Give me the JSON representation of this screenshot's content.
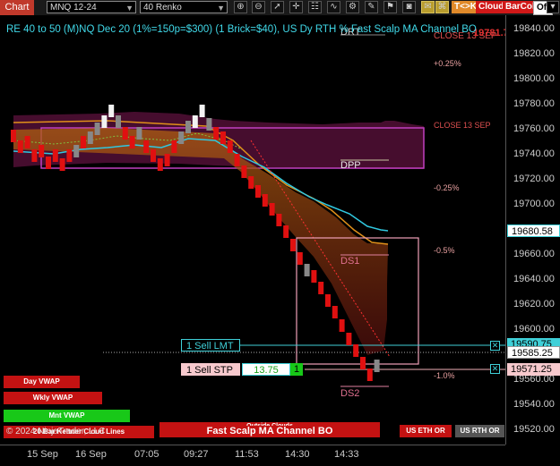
{
  "toolbar": {
    "chart_tab": "Chart",
    "instrument": "MNQ 12-24",
    "period": "40 Renko",
    "flags": [
      {
        "label": "T<>K",
        "color": "#e08a2a"
      },
      {
        "label": "Cloud",
        "color": "#d01818"
      },
      {
        "label": "BarCol",
        "color": "#d01818"
      },
      {
        "label": "Off",
        "color": "#ffffff"
      }
    ]
  },
  "chart": {
    "title": "RE 40 to 50 (M)NQ Dec 20 (1%=150p=$300) (1 Brick=$40), US Dy RTH % Fast Scalp MA Channel BO",
    "top_right_label": "CLOSE 13 SEP",
    "top_price": "19781.75",
    "drt": "DRT",
    "close_label": "CLOSE 13 SEP",
    "pct_labels": [
      "+0.25%",
      "-0.25%",
      "-0.5%",
      "-1.0%"
    ],
    "zones": {
      "dpp": "DPP",
      "ds1": "DS1",
      "ds2": "DS2"
    },
    "copyright": "© 2024 NinjaTrader, LLC",
    "outside_clouds": "Outside Clouds",
    "strategy_banner": "Fast Scalp MA Channel BO",
    "left_buttons": [
      {
        "label": "Day VWAP",
        "color": "#c41212"
      },
      {
        "label": "Wkly VWAP",
        "color": "#c41212"
      },
      {
        "label": "Mnt VWAP",
        "color": "#18c818"
      },
      {
        "label": "20 Bar Keltner Cloud Lines",
        "color": "#c41212"
      }
    ],
    "right_buttons": [
      {
        "label": "US ETH OR",
        "color": "#c41212"
      },
      {
        "label": "US RTH OR",
        "color": "#555555"
      }
    ]
  },
  "orders": {
    "sell_lmt": "1 Sell LMT",
    "sell_stp": "1 Sell STP",
    "stp_pnl": "13.75",
    "stp_qty": "1",
    "lmt_close": "✕",
    "stp_close": "✕"
  },
  "price_axis": {
    "labels": [
      "19840.00",
      "19820.00",
      "19800.00",
      "19780.00",
      "19760.00",
      "19740.00",
      "19720.00",
      "19700.00",
      "19660.00",
      "19640.00",
      "19620.00",
      "19600.00",
      "19560.00",
      "19540.00",
      "19520.00"
    ],
    "flags": [
      {
        "label": "19680.58",
        "bg": "#ffffff",
        "fg": "#000000",
        "border": "#3fd0d8"
      },
      {
        "label": "19590.75",
        "bg": "#3fd0d8",
        "fg": "#000000",
        "border": "#3fd0d8"
      },
      {
        "label": "19585.25",
        "bg": "#ffffff",
        "fg": "#000000",
        "border": "#999999"
      },
      {
        "label": "19571.25",
        "bg": "#f7c9cd",
        "fg": "#000000",
        "border": "#f7c9cd"
      }
    ]
  },
  "time_axis": {
    "labels": [
      "15 Sep",
      "16 Sep",
      "07:05",
      "09:27",
      "11:53",
      "14:30",
      "14:33"
    ]
  }
}
